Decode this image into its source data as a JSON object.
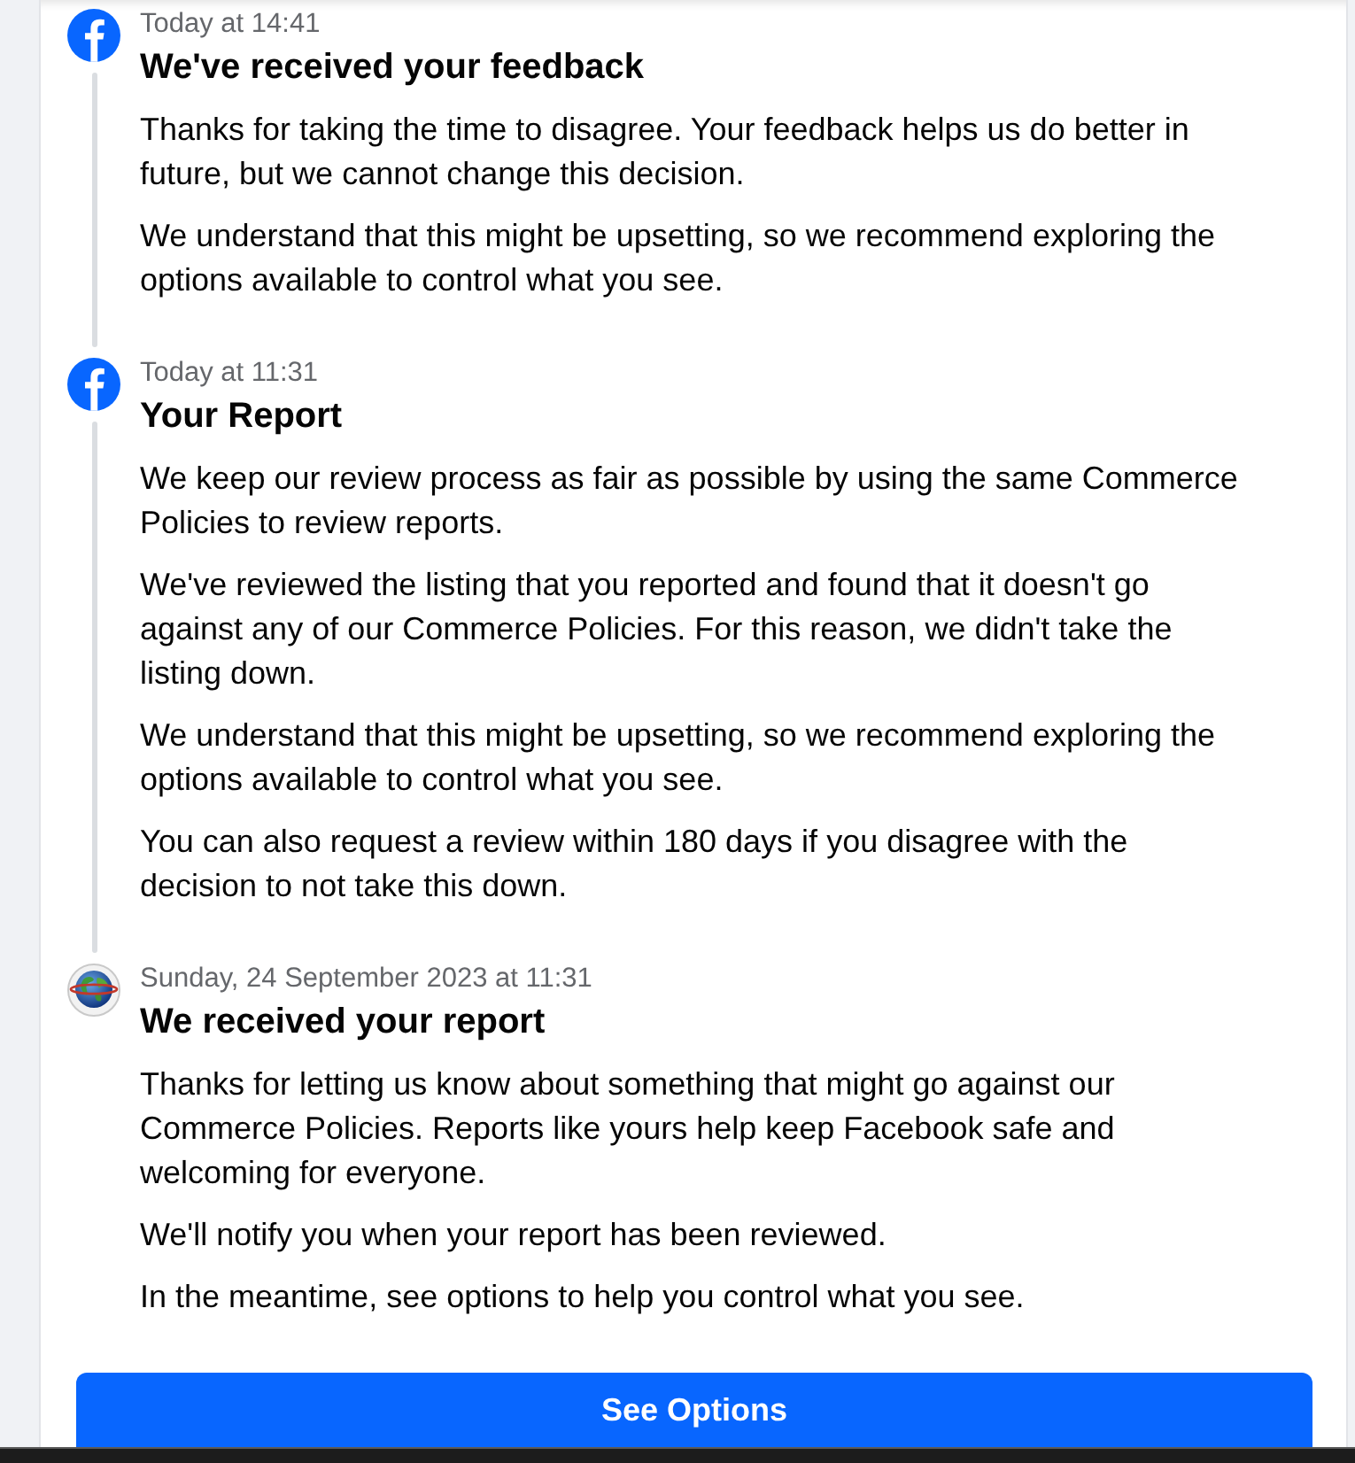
{
  "entries": [
    {
      "kind": "logo",
      "time": "Today at 14:41",
      "title": "We've received your feedback",
      "paragraphs": [
        "Thanks for taking the time to disagree. Your feedback helps us do better in future, but we cannot change this decision.",
        "We understand that this might be upsetting, so we recommend exploring the options available to control what you see."
      ]
    },
    {
      "kind": "logo",
      "time": "Today at 11:31",
      "title": "Your Report",
      "paragraphs": [
        "We keep our review process as fair as possible by using the same Commerce Policies to review reports.",
        "We've reviewed the listing that you reported and found that it doesn't go against any of our Commerce Policies. For this reason, we didn't take the listing down.",
        "We understand that this might be upsetting, so we recommend exploring the options available to control what you see.",
        "You can also request a review within 180 days if you disagree with the decision to not take this down."
      ]
    },
    {
      "kind": "globe",
      "time": "Sunday, 24 September 2023 at 11:31",
      "title": "We received your report",
      "paragraphs": [
        "Thanks for letting us know about something that might go against our Commerce Policies. Reports like yours help keep Facebook safe and welcoming for everyone.",
        "We'll notify you when your report has been reviewed.",
        "In the meantime, see options to help you control what you see."
      ]
    }
  ],
  "button": "See Options"
}
